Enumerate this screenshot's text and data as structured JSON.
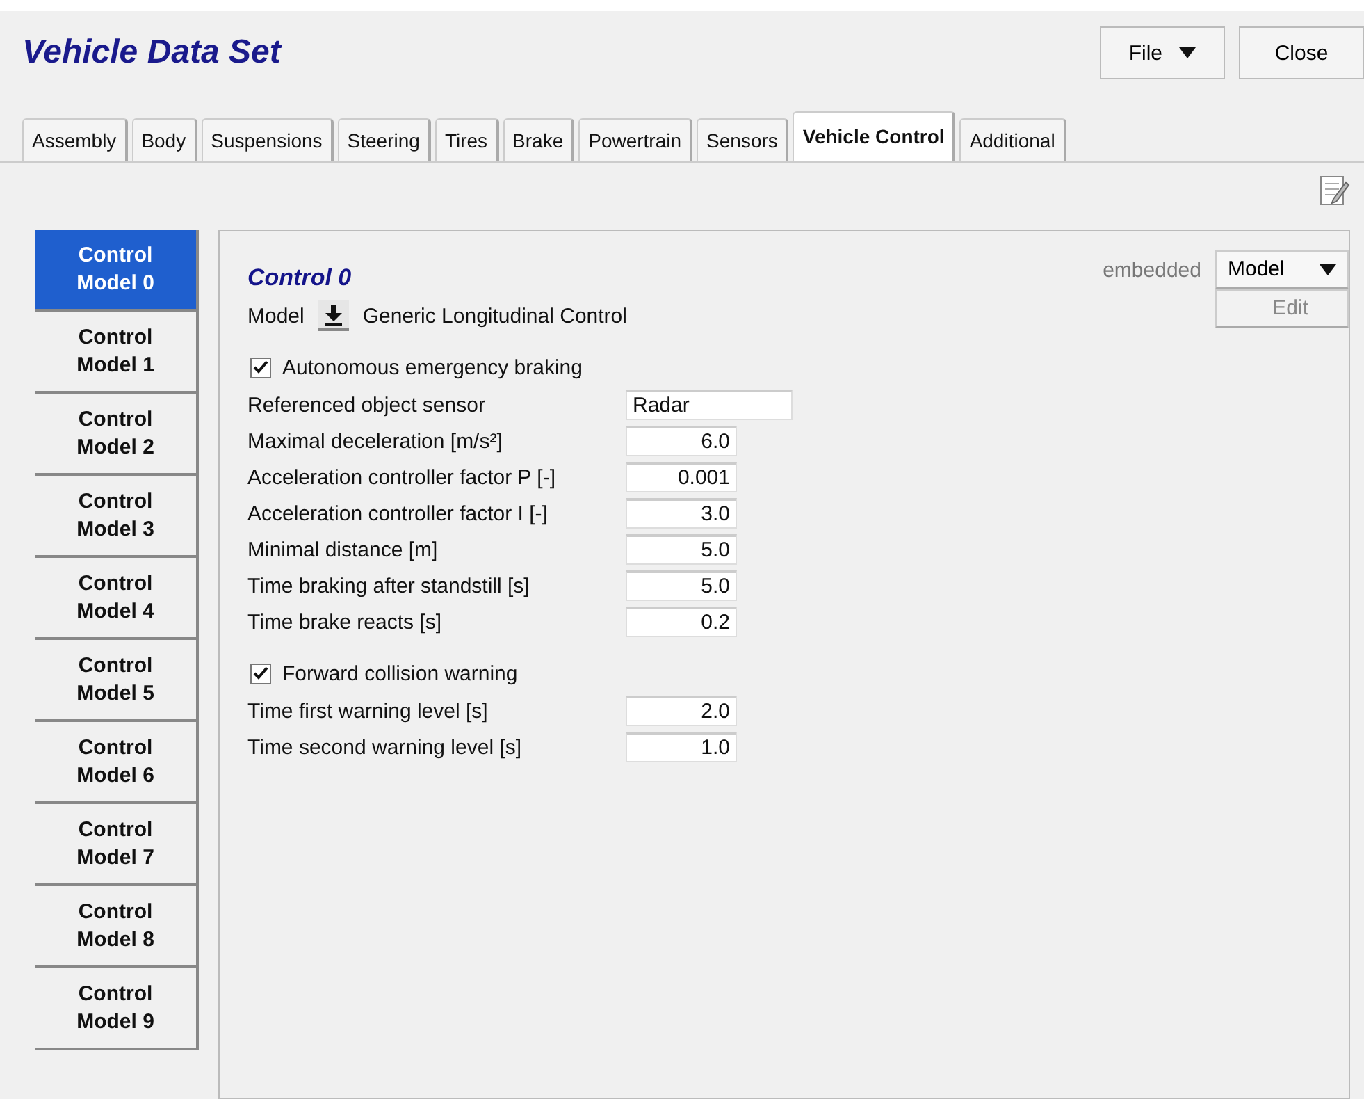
{
  "window": {
    "title": "Vehicle Data Set"
  },
  "header_buttons": [
    {
      "label": "File",
      "kind": "dropdown"
    },
    {
      "label": "Close",
      "kind": "plain"
    }
  ],
  "tabs": [
    {
      "label": "Assembly",
      "selected": false
    },
    {
      "label": "Body",
      "selected": false
    },
    {
      "label": "Suspensions",
      "selected": false
    },
    {
      "label": "Steering",
      "selected": false
    },
    {
      "label": "Tires",
      "selected": false
    },
    {
      "label": "Brake",
      "selected": false
    },
    {
      "label": "Powertrain",
      "selected": false
    },
    {
      "label": "Sensors",
      "selected": false
    },
    {
      "label": "Vehicle Control",
      "selected": true
    },
    {
      "label": "Additional",
      "selected": false
    }
  ],
  "sidebar": {
    "items": [
      {
        "label": "Control Model 0",
        "selected": true
      },
      {
        "label": "Control Model 1",
        "selected": false
      },
      {
        "label": "Control Model 2",
        "selected": false
      },
      {
        "label": "Control Model 3",
        "selected": false
      },
      {
        "label": "Control Model 4",
        "selected": false
      },
      {
        "label": "Control Model 5",
        "selected": false
      },
      {
        "label": "Control Model 6",
        "selected": false
      },
      {
        "label": "Control Model 7",
        "selected": false
      },
      {
        "label": "Control Model 8",
        "selected": false
      },
      {
        "label": "Control Model 9",
        "selected": false
      }
    ]
  },
  "panel": {
    "title": "Control 0",
    "model_label": "Model",
    "model_name": "Generic Longitudinal Control",
    "mode": "embedded",
    "mode_button": "Model",
    "edit_button": {
      "label": "Edit",
      "disabled": true
    },
    "rows": [
      {
        "kind": "checkbox",
        "label": "Autonomous emergency braking",
        "checked": true
      },
      {
        "kind": "text",
        "label": "Referenced object sensor",
        "value": "Radar"
      },
      {
        "kind": "number",
        "label": "Maximal deceleration [m/s²]",
        "value": "6.0"
      },
      {
        "kind": "number",
        "label": "Acceleration controller factor P [-]",
        "value": "0.001"
      },
      {
        "kind": "number",
        "label": "Acceleration controller factor I [-]",
        "value": "3.0"
      },
      {
        "kind": "number",
        "label": "Minimal distance [m]",
        "value": "5.0"
      },
      {
        "kind": "number",
        "label": "Time braking after standstill [s]",
        "value": "5.0"
      },
      {
        "kind": "number",
        "label": "Time brake reacts [s]",
        "value": "0.2"
      },
      {
        "kind": "checkbox",
        "label": "Forward collision warning",
        "checked": true
      },
      {
        "kind": "number",
        "label": "Time first warning level [s]",
        "value": "2.0"
      },
      {
        "kind": "number",
        "label": "Time second warning level [s]",
        "value": "1.0"
      }
    ]
  }
}
